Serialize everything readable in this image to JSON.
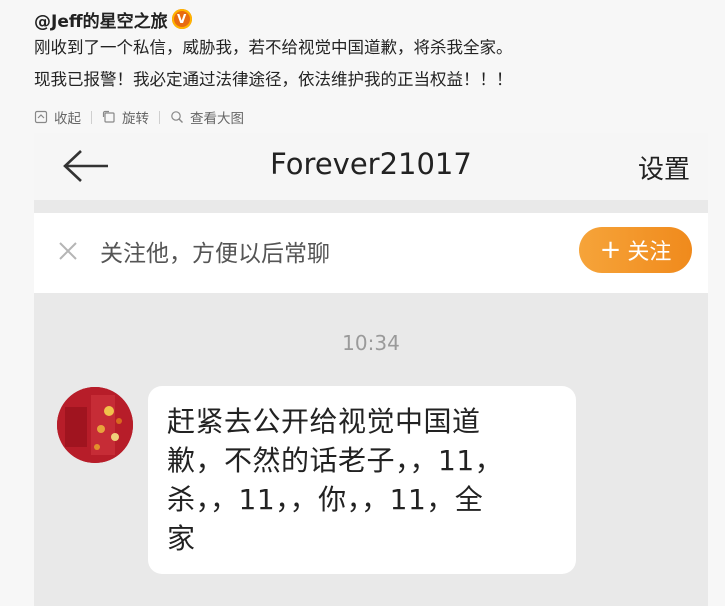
{
  "post": {
    "author": "@Jeff的星空之旅",
    "verified_badge": "V",
    "line1": "刚收到了一个私信，威胁我，若不给视觉中国道歉，将杀我全家。",
    "line2": "现我已报警！我必定通过法律途径，依法维护我的正当权益！！！",
    "actions": {
      "collapse": "收起",
      "rotate": "旋转",
      "view_large": "查看大图"
    }
  },
  "chat": {
    "title": "Forever21017",
    "settings": "设置",
    "follow_hint": "关注他，方便以后常聊",
    "follow_button": "关注",
    "timestamp": "10:34",
    "message": "赶紧去公开给视觉中国道\n歉，不然的话老子，，11，\n杀，，11，，你，，11，全\n家"
  },
  "icons": {
    "collapse": "collapse-icon",
    "rotate": "rotate-icon",
    "view_large": "view-large-icon",
    "back": "back-arrow-icon",
    "close": "close-icon",
    "verified": "verified-icon"
  },
  "colors": {
    "follow_button": "#f39a2c",
    "verified": "#e86b10",
    "chat_background": "#e9e9e9"
  }
}
